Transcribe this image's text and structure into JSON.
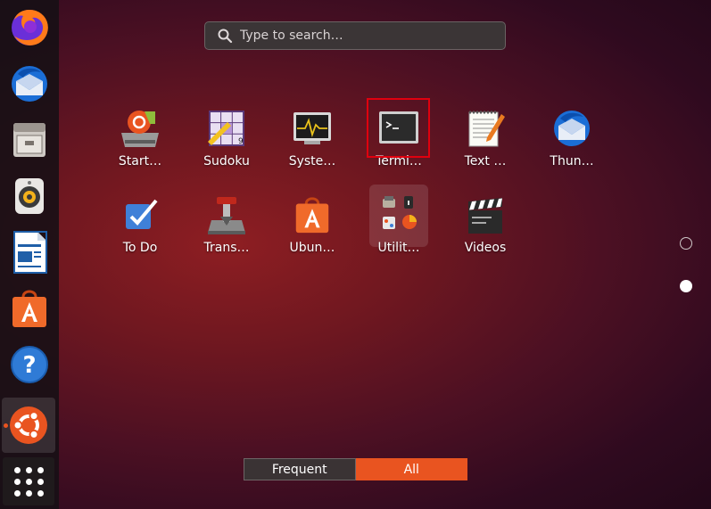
{
  "search": {
    "placeholder": "Type to search…"
  },
  "dock": {
    "items": [
      {
        "name": "Firefox",
        "icon": "firefox-icon"
      },
      {
        "name": "Thunderbird",
        "icon": "thunderbird-icon"
      },
      {
        "name": "Files",
        "icon": "files-icon"
      },
      {
        "name": "Rhythmbox",
        "icon": "rhythmbox-icon"
      },
      {
        "name": "LibreOffice Writer",
        "icon": "writer-icon"
      },
      {
        "name": "Ubuntu Software",
        "icon": "software-icon"
      },
      {
        "name": "Help",
        "icon": "help-icon"
      },
      {
        "name": "Ubuntu",
        "icon": "ubuntu-icon"
      },
      {
        "name": "Show Applications",
        "icon": "app-grid-icon"
      }
    ]
  },
  "apps": [
    {
      "label": "Start…",
      "icon": "startup-disk-creator-icon"
    },
    {
      "label": "Sudoku",
      "icon": "sudoku-icon"
    },
    {
      "label": "Syste…",
      "icon": "system-monitor-icon"
    },
    {
      "label": "Termi…",
      "icon": "terminal-icon"
    },
    {
      "label": "Text …",
      "icon": "text-editor-icon"
    },
    {
      "label": "Thun…",
      "icon": "thunderbird-icon"
    },
    {
      "label": "To Do",
      "icon": "todo-icon"
    },
    {
      "label": "Trans…",
      "icon": "transmission-icon"
    },
    {
      "label": "Ubun…",
      "icon": "ubuntu-software-icon"
    },
    {
      "label": "Utilit…",
      "icon": "utilities-folder-icon"
    },
    {
      "label": "Videos",
      "icon": "videos-icon"
    }
  ],
  "switcher": {
    "frequent": "Frequent",
    "all": "All",
    "selected": "All"
  },
  "colors": {
    "accent": "#e95420",
    "highlight": "#e0000e"
  }
}
